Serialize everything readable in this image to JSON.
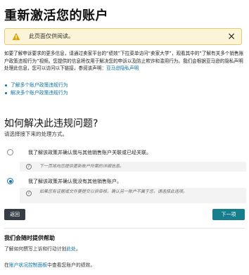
{
  "page": {
    "title": "重新激活您的账户"
  },
  "alert": {
    "message": "此页面仅供阅读。",
    "close": "×"
  },
  "intro": {
    "text_1": "如要了解申诉要求的更多信息，请通过卖家平台的“绩效”下拉菜单访问“卖家大学”，观看其中的“了解有关多个销售账户政策违规行为”视频。您提供的信息将仅用于解决您的申诉以及防止欺诈和滥用行为。我们会根据亚马逊的隐私声明处理此信息，您可以访问以下链接，参阅该声明：",
    "privacy_link": "亚马逊隐私声明"
  },
  "links": [
    "了解多个账户政策违规行为",
    "解决多个账户政策违规行为"
  ],
  "resolve": {
    "heading": "如何解决此违规问题?",
    "subheading": "请选择接下来的处理方式。"
  },
  "options": [
    {
      "label": "我了解该政策并确认我与其他销售账户关联或已经关联。",
      "selected": false,
      "note": "下一页将向您提供更新账户所需的详细信息。"
    },
    {
      "label": "我了解该政策并确认我没有其他销售账户。",
      "selected": true,
      "note": "如果您有证据或文件要提交以供审核，确认另一账户不属于您，请选择此选项。"
    }
  ],
  "buttons": {
    "back": "返回",
    "next": "下一项"
  },
  "help": {
    "title": "我们会随时提供帮助",
    "text_before": "了解如何撰写上诉和行动计划",
    "link": "此处",
    "text_after": "。"
  },
  "status": {
    "text_before": "在",
    "link": "账户状况控制面板",
    "text_after": "中查看您账户的绩效。"
  },
  "colors": {
    "primary_button": "#177e8d",
    "back_button": "#363d45",
    "link": "#0b71a5",
    "alert_bg": "#fcf4d6"
  }
}
